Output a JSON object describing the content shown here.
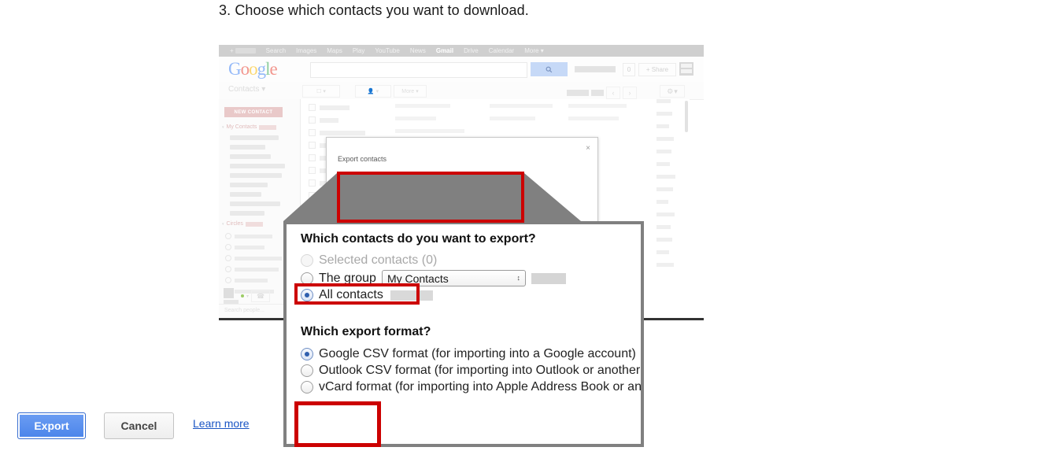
{
  "caption": "3. Choose which contacts you want to download.",
  "browser": {
    "google_bar": {
      "plus_label": "+",
      "items": [
        "Search",
        "Images",
        "Maps",
        "Play",
        "YouTube",
        "News",
        "Gmail",
        "Drive",
        "Calendar",
        "More"
      ],
      "active_item": "Gmail",
      "more_caret": "▾"
    },
    "logo": {
      "letters": [
        "G",
        "o",
        "o",
        "g",
        "l",
        "e"
      ]
    },
    "search": {
      "value": "",
      "icon": "search-icon"
    },
    "account": {
      "count": "0",
      "share_label": "+ Share",
      "avatar": "avatar"
    },
    "toolbar": {
      "title": "Contacts",
      "title_caret": "▾",
      "select_caret": "▾",
      "add_person_caret": "▾",
      "more_label": "More",
      "more_caret": "▾",
      "prev_arrow": "‹",
      "next_arrow": "›",
      "gear_icon": "gear-icon",
      "gear_caret": "▾"
    },
    "sidebar": {
      "new_contact_label": "NEW CONTACT",
      "groups": [
        {
          "label": "My Contacts",
          "caret": "▾"
        },
        {
          "label": "Circles",
          "caret": "▾"
        }
      ],
      "search_placeholder": "Search people..."
    }
  },
  "mini_dialog": {
    "title": "Export contacts",
    "close_icon": "×",
    "question": "Which contacts do you want to export?",
    "options": [
      {
        "label": "Selected contacts (0)",
        "state": "disabled"
      },
      {
        "label": "The group",
        "state": "off"
      },
      {
        "label": "All contacts",
        "state": "on"
      }
    ],
    "group_select": {
      "value": "My Contacts",
      "arrows": "↕"
    }
  },
  "magnified": {
    "question_contacts": "Which contacts do you want to export?",
    "contact_options": [
      {
        "label": "Selected contacts (0)",
        "state": "disabled"
      },
      {
        "label": "The group",
        "state": "off"
      },
      {
        "label": "All contacts",
        "state": "on"
      }
    ],
    "group_select": {
      "value": "My Contacts",
      "arrows": "↕"
    },
    "question_format": "Which export format?",
    "format_options": [
      {
        "label": "Google CSV format (for importing into a Google account)",
        "state": "on"
      },
      {
        "label": "Outlook CSV format (for importing into Outlook or another",
        "state": "off"
      },
      {
        "label": "vCard format (for importing into Apple Address Book or an",
        "state": "off"
      }
    ],
    "buttons": {
      "export": "Export",
      "cancel": "Cancel",
      "learn_more": "Learn more"
    }
  },
  "highlight_color": "#cc0000",
  "accent_color": "#4a84ea"
}
